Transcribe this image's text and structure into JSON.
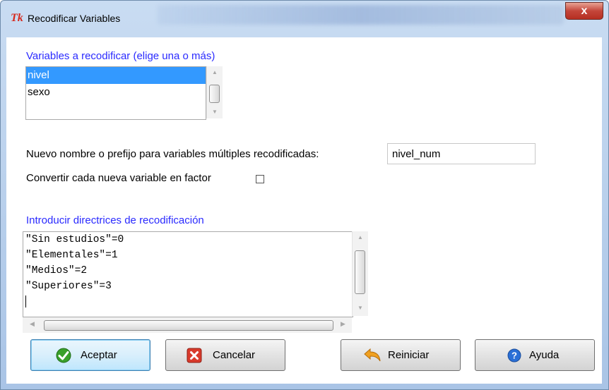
{
  "window": {
    "title": "Recodificar Variables",
    "app_icon": "Tk",
    "close_label": "x"
  },
  "variables": {
    "label": "Variables a recodificar (elige una o más)",
    "items": [
      "nivel",
      "sexo"
    ],
    "selected": "nivel"
  },
  "new_name": {
    "label": "Nuevo nombre o prefijo para variables múltiples recodificadas:",
    "value": "nivel_num"
  },
  "factor": {
    "label": "Convertir cada nueva variable en factor",
    "checked": false
  },
  "directives": {
    "label": "Introducir directrices de recodificación",
    "lines": [
      "\"Sin estudios\"=0",
      "\"Elementales\"=1",
      "\"Medios\"=2",
      "\"Superiores\"=3"
    ]
  },
  "buttons": {
    "ok": "Aceptar",
    "cancel": "Cancelar",
    "reset": "Reiniciar",
    "help": "Ayuda"
  },
  "colors": {
    "label_blue": "#2a2aff",
    "selection": "#3399ff",
    "close_red": "#c4463a",
    "ok_green": "#3aa02a",
    "cancel_red": "#d93a2b",
    "reset_orange": "#f0a020",
    "help_blue": "#2a6fd6"
  }
}
